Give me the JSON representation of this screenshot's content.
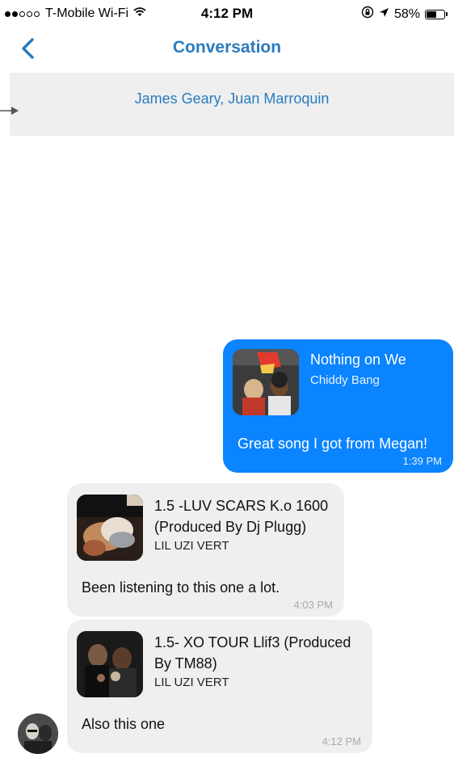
{
  "status_bar": {
    "carrier": "T-Mobile Wi-Fi",
    "time": "4:12 PM",
    "battery_percent": "58%",
    "battery_level": 0.58,
    "signal_bars_filled": 2,
    "signal_bars_total": 5
  },
  "nav": {
    "title": "Conversation",
    "back_icon": "chevron-left-icon",
    "accent_color": "#2a7bbf"
  },
  "participants": {
    "names": "James Geary, Juan Marroquin"
  },
  "messages": [
    {
      "direction": "sent",
      "song_title": "Nothing on We",
      "song_artist": "Chiddy Bang",
      "text": "Great song I got from Megan!",
      "time": "1:39 PM",
      "color": "#0a84ff"
    },
    {
      "direction": "received",
      "song_title_line1": "1.5 -LUV SCARS K.o 1600",
      "song_title_line2": "(Produced By Dj Plugg)",
      "song_artist": "LIL UZI VERT",
      "text": "Been listening to this one a lot.",
      "time": "4:03 PM"
    },
    {
      "direction": "received",
      "song_title_line1": "1.5- XO TOUR Llif3 (Produced",
      "song_title_line2": "By TM88)",
      "song_artist": "LIL UZI VERT",
      "text": "Also this one",
      "time": "4:12 PM"
    }
  ]
}
